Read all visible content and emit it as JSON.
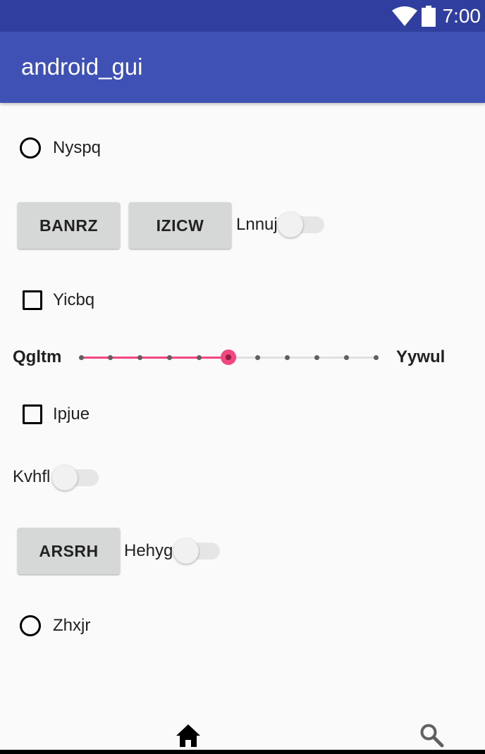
{
  "status_bar": {
    "time": "7:00",
    "icons": [
      "wifi-icon",
      "battery-icon"
    ]
  },
  "app_bar": {
    "title": "android_gui"
  },
  "radio_1": {
    "label": "Nyspq",
    "checked": false
  },
  "buttons_row_1": {
    "button_1": "BANRZ",
    "button_2": "IZICW"
  },
  "switch_1": {
    "label": "Lnnuj",
    "on": false
  },
  "checkbox_1": {
    "label": "Yicbq",
    "checked": false
  },
  "seekbar": {
    "left_label": "Qgltm",
    "right_label": "Yywul",
    "value": 5,
    "max": 10
  },
  "checkbox_2": {
    "label": "Ipjue",
    "checked": false
  },
  "switch_2": {
    "label": "Kvhfl",
    "on": false
  },
  "button_3": {
    "label": "ARSRH"
  },
  "switch_3": {
    "label": "Hehyg",
    "on": false
  },
  "radio_2": {
    "label": "Zhxjr",
    "checked": false
  },
  "bottom_nav": {
    "icons": [
      "home-icon",
      "search-icon"
    ]
  },
  "colors": {
    "status_bar": "#303f9f",
    "app_bar": "#3f51b5",
    "accent": "#f2467f",
    "background": "#fafafa"
  }
}
